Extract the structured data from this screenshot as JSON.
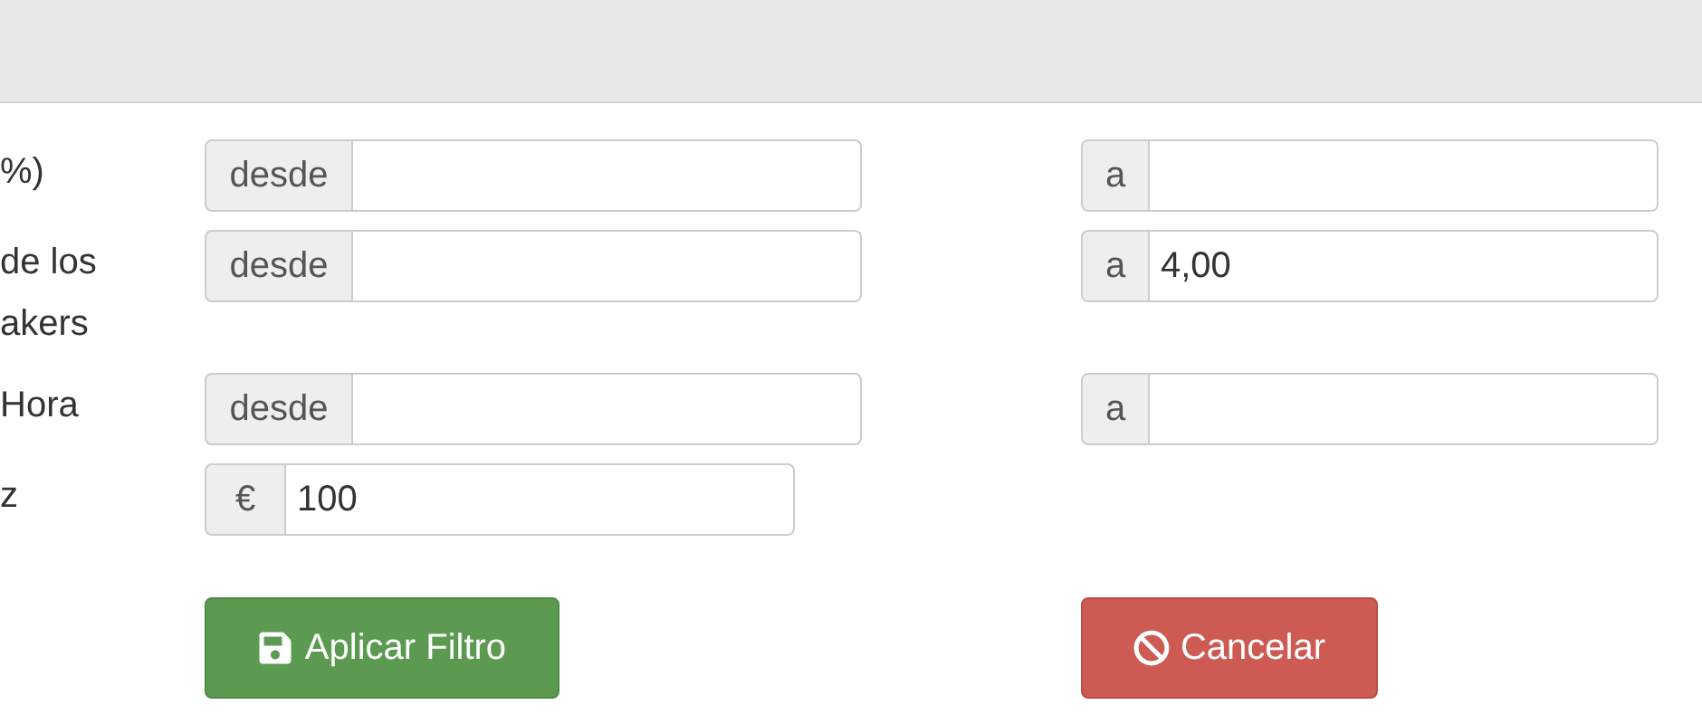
{
  "rows": [
    {
      "label": [
        "%)"
      ],
      "from": {
        "addon": "desde"
      },
      "to": {
        "addon": "a"
      }
    },
    {
      "label": [
        "de los",
        "akers"
      ],
      "from": {
        "addon": "desde"
      },
      "to": {
        "addon": "a",
        "value": "4,00"
      }
    },
    {
      "label": [
        "Hora"
      ],
      "from": {
        "addon": "desde"
      },
      "to": {
        "addon": "a"
      }
    },
    {
      "label": [
        "z"
      ],
      "from": {
        "addon": "€",
        "value": "100"
      }
    }
  ],
  "buttons": [
    {
      "kind": "apply",
      "label": "Aplicar Filtro"
    },
    {
      "kind": "cancel",
      "label": "Cancelar"
    }
  ]
}
